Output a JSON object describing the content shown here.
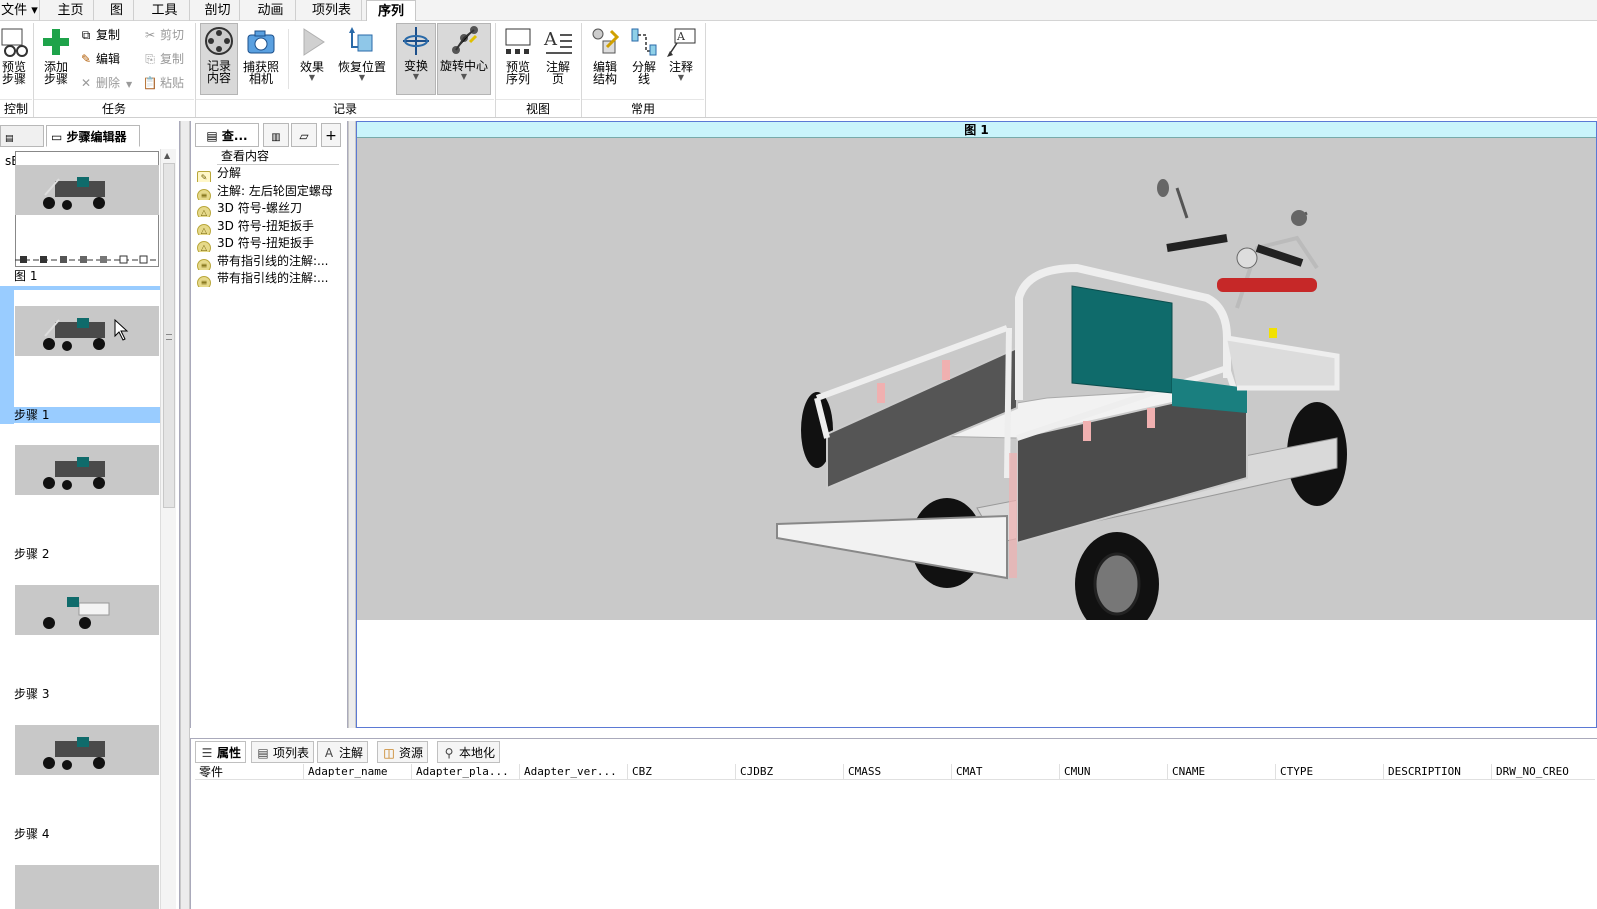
{
  "menu": {
    "items": [
      {
        "label": "文件 ▾"
      },
      {
        "label": "主页"
      },
      {
        "label": "图"
      },
      {
        "label": "工具"
      },
      {
        "label": "剖切"
      },
      {
        "label": "动画"
      },
      {
        "label": "项列表"
      },
      {
        "label": "序列"
      }
    ]
  },
  "ribbon": {
    "groups": {
      "control": "控制",
      "task": "任务",
      "record": "记录",
      "view": "视图",
      "common": "常用"
    },
    "buttons": {
      "preview_step": "预览\n步骤",
      "add_step": "添加\n步骤",
      "copy": "复制",
      "edit": "编辑",
      "delete": "删除",
      "cut": "剪切",
      "copy2": "复制",
      "paste": "粘贴",
      "record_content": "记录\n内容",
      "capture_camera": "捕获照\n相机",
      "effect": "效果",
      "restore_position": "恢复位置",
      "transform": "变换",
      "rotate_center": "旋转中心",
      "preview_sequence": "预览\n序列",
      "annotation_page": "注解\n页",
      "edit_structure": "编辑\n结构",
      "explode_line": "分解\n线",
      "annotate": "注释"
    }
  },
  "left_panel": {
    "tabs": [
      "sBOM",
      "步骤编辑器"
    ],
    "steps": [
      {
        "label": "图 1"
      },
      {
        "label": "步骤 1"
      },
      {
        "label": "步骤 2"
      },
      {
        "label": "步骤 3"
      },
      {
        "label": "步骤 4"
      }
    ]
  },
  "mid_panel": {
    "tab_label": "查...",
    "heading": "查看内容",
    "items": [
      {
        "label": "分解",
        "icon": "explode-icon"
      },
      {
        "label": "注解: 左后轮固定螺母",
        "icon": "note-icon"
      },
      {
        "label": "3D 符号-螺丝刀",
        "icon": "symbol-icon"
      },
      {
        "label": "3D 符号-扭矩扳手",
        "icon": "symbol-icon"
      },
      {
        "label": "3D 符号-扭矩扳手",
        "icon": "symbol-icon"
      },
      {
        "label": "带有指引线的注解:...",
        "icon": "note-icon"
      },
      {
        "label": "带有指引线的注解:...",
        "icon": "note-icon"
      }
    ]
  },
  "viewport": {
    "title": "图 1"
  },
  "bottom_panel": {
    "tabs": [
      "属性",
      "项列表",
      "注解",
      "资源",
      "本地化"
    ],
    "columns": [
      "零件",
      "Adapter_name",
      "Adapter_pla...",
      "Adapter_ver...",
      "CBZ",
      "CJDBZ",
      "CMASS",
      "CMAT",
      "CMUN",
      "CNAME",
      "CTYPE",
      "DESCRIPTION",
      "DRW_NO_CREO"
    ]
  },
  "colors": {
    "viewport_title_bg": "#c9f4fb",
    "viewport_bg": "#c9c9c9",
    "selection": "#99ccff",
    "cabin_teal": "#0f6b6b"
  }
}
